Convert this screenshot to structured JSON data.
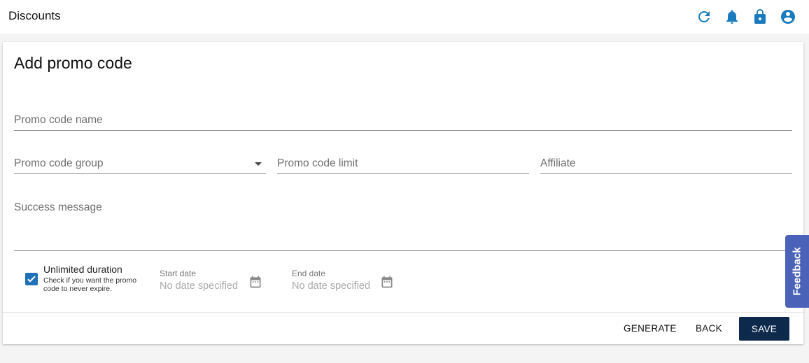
{
  "header": {
    "title": "Discounts",
    "icons": [
      "refresh-icon",
      "bell-icon",
      "lock-icon",
      "account-icon"
    ],
    "icon_color": "#1a7bbf"
  },
  "form": {
    "title": "Add promo code",
    "promo_code_name": "Promo code name",
    "promo_code_group": "Promo code group",
    "promo_code_limit": "Promo code limit",
    "affiliate": "Affiliate",
    "success_message": "Success message",
    "unlimited_duration": {
      "label": "Unlimited duration",
      "help": "Check if you want the promo code to never expire.",
      "checked": true
    },
    "start_date": {
      "label": "Start date",
      "value": "No date specified"
    },
    "end_date": {
      "label": "End date",
      "value": "No date specified"
    }
  },
  "actions": {
    "generate": "GENERATE",
    "back": "BACK",
    "save": "SAVE"
  },
  "feedback_tab": "Feedback",
  "colors": {
    "primary": "#0d2a4d",
    "accent": "#1a7bbf",
    "checkbox": "#1f72b8",
    "feedback": "#4a63b8"
  }
}
